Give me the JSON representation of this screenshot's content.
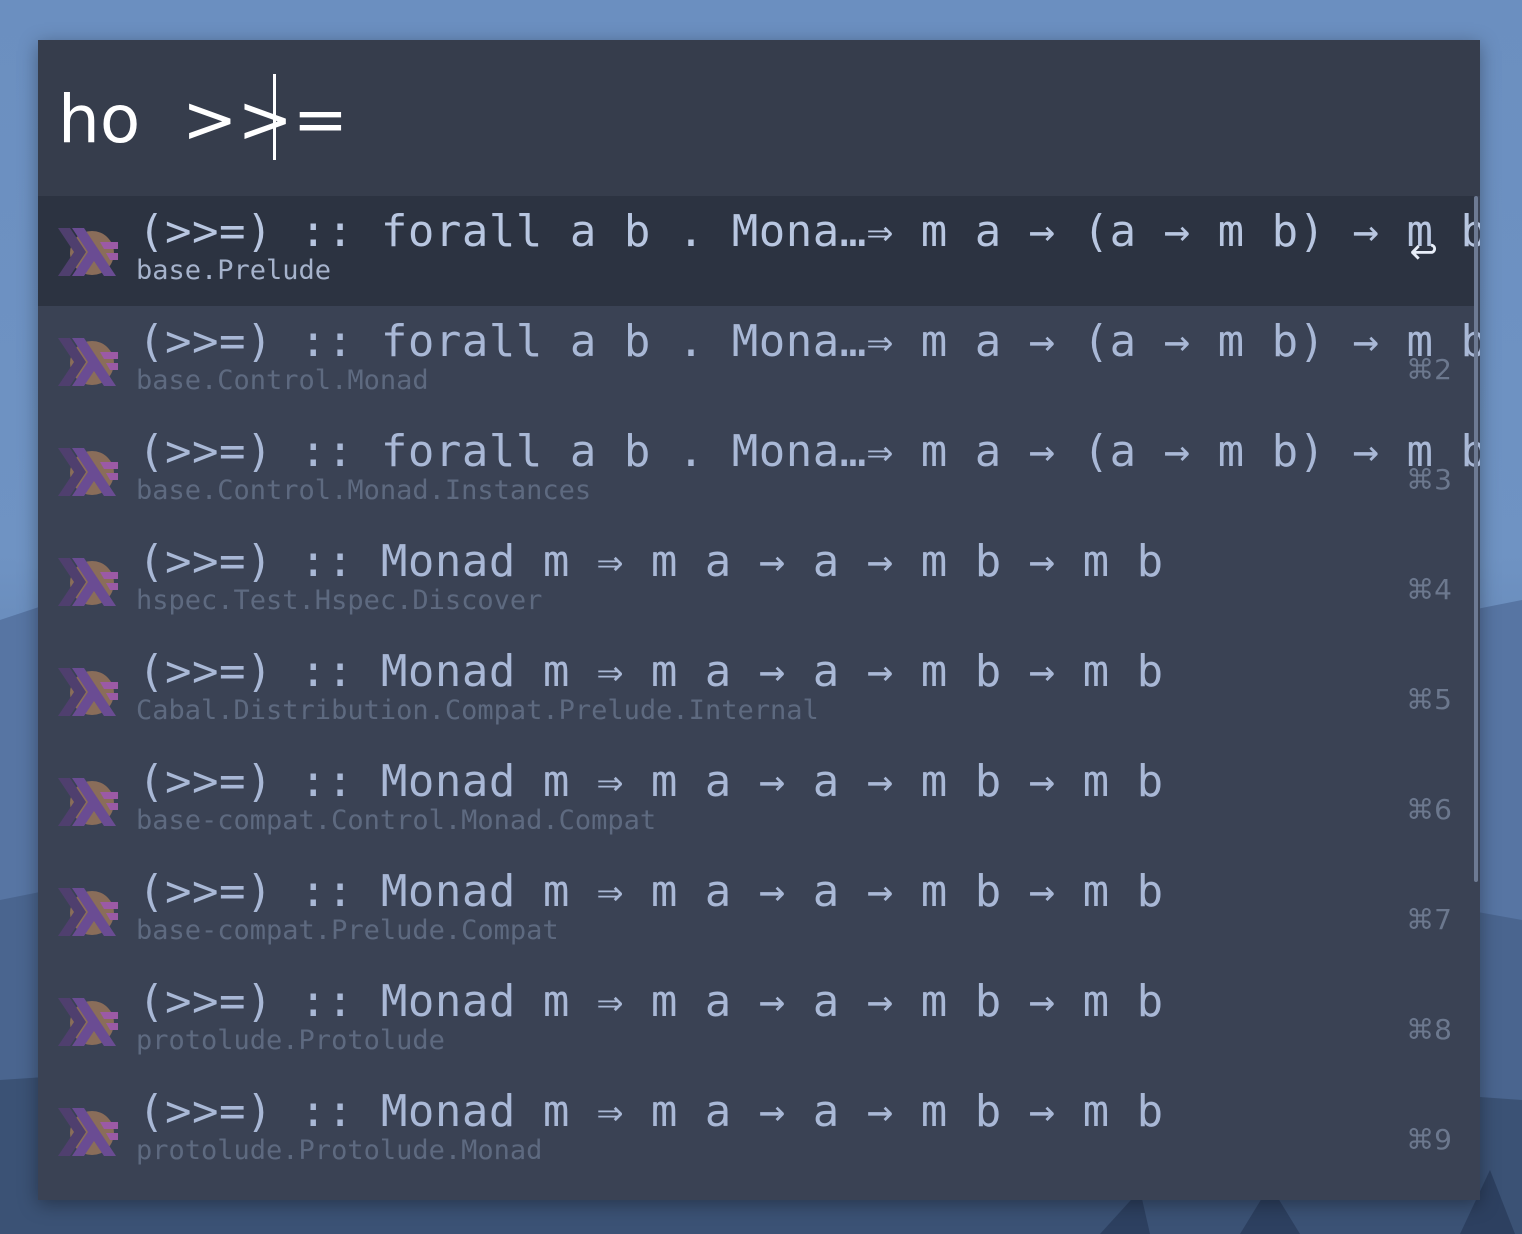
{
  "search": {
    "query": "ho  >>="
  },
  "results": [
    {
      "signature": "(>>=) :: forall a b . Mona…⇒ m a → (a → m b) → m b",
      "module": "base.Prelude",
      "shortcut": "↩",
      "selected": true
    },
    {
      "signature": "(>>=) :: forall a b . Mona…⇒ m a → (a → m b) → m b",
      "module": "base.Control.Monad",
      "shortcut": "⌘2"
    },
    {
      "signature": "(>>=) :: forall a b . Mona…⇒ m a → (a → m b) → m b",
      "module": "base.Control.Monad.Instances",
      "shortcut": "⌘3"
    },
    {
      "signature": "(>>=) :: Monad m ⇒ m a → a → m b → m b",
      "module": "hspec.Test.Hspec.Discover",
      "shortcut": "⌘4"
    },
    {
      "signature": "(>>=) :: Monad m ⇒ m a → a → m b → m b",
      "module": "Cabal.Distribution.Compat.Prelude.Internal",
      "shortcut": "⌘5"
    },
    {
      "signature": "(>>=) :: Monad m ⇒ m a → a → m b → m b",
      "module": "base-compat.Control.Monad.Compat",
      "shortcut": "⌘6"
    },
    {
      "signature": "(>>=) :: Monad m ⇒ m a → a → m b → m b",
      "module": "base-compat.Prelude.Compat",
      "shortcut": "⌘7"
    },
    {
      "signature": "(>>=) :: Monad m ⇒ m a → a → m b → m b",
      "module": "protolude.Protolude",
      "shortcut": "⌘8"
    },
    {
      "signature": "(>>=) :: Monad m ⇒ m a → a → m b → m b",
      "module": "protolude.Protolude.Monad",
      "shortcut": "⌘9"
    }
  ],
  "icon": "haskell-logo-icon",
  "colors": {
    "panel": "#353d4d",
    "selected_row": "#2c3341",
    "title_text": "#a9b8d6",
    "module_text": "#5e6a80"
  }
}
